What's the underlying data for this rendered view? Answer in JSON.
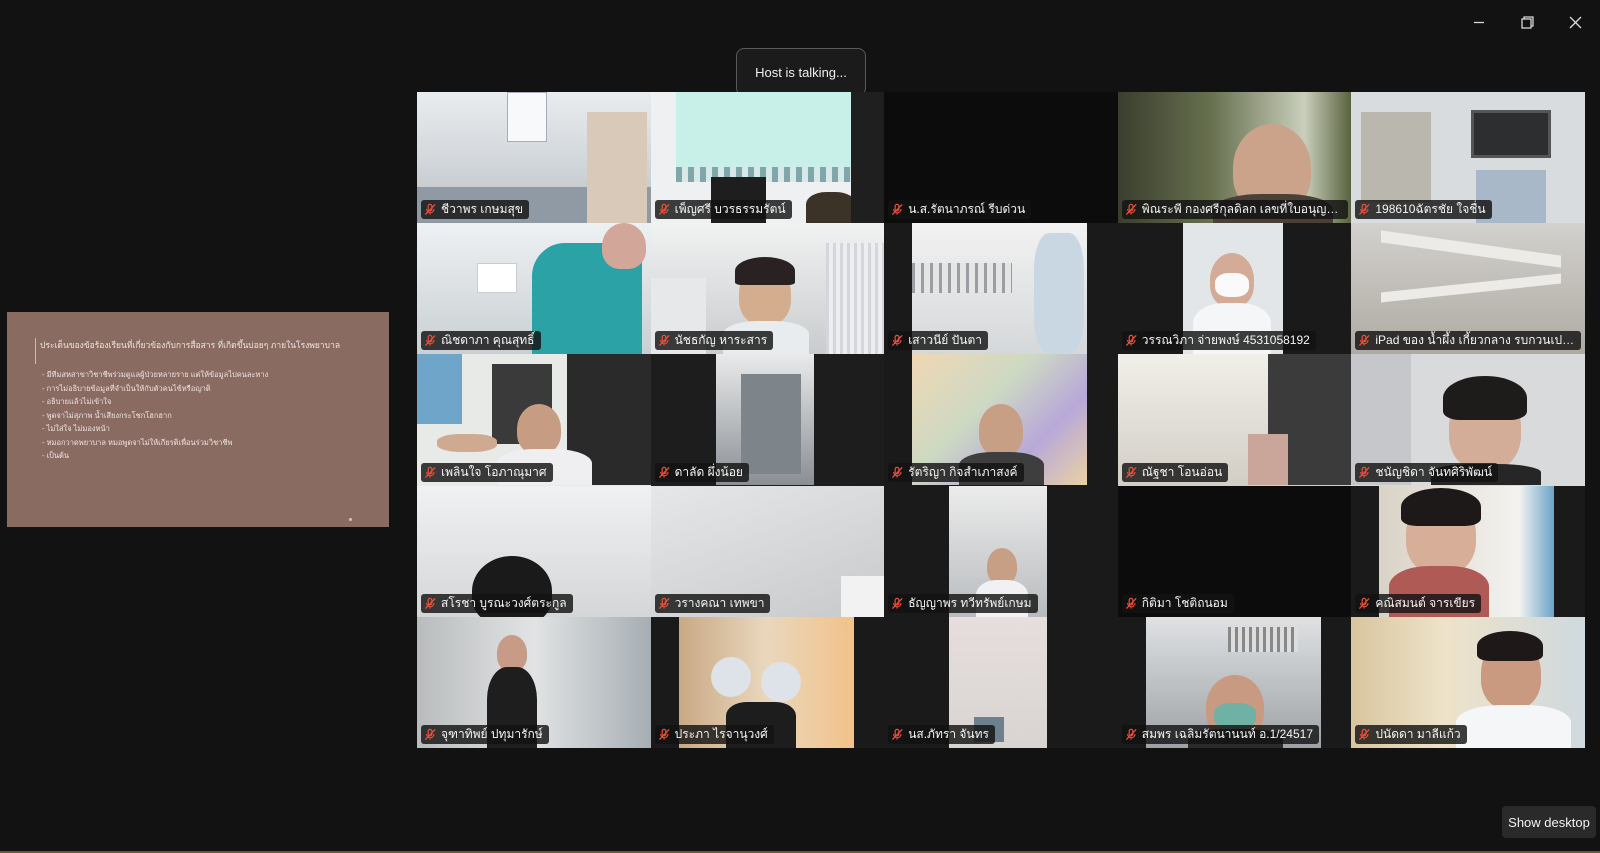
{
  "toast": {
    "text": "Host is talking..."
  },
  "slide": {
    "title": "ประเด็นของข้อร้องเรียนที่เกี่ยวข้องกับการสื่อสาร ที่เกิดขึ้นบ่อยๆ ภายในโรงพยาบาล",
    "items": [
      "- มีทีมสหสาขาวิชาชีพร่วมดูแลผู้ป่วยหลายราย แต่ให้ข้อมูลไปคนละทาง",
      "- การไม่อธิบายข้อมูลที่จำเป็นให้กับตัวคนไข้หรือญาติ",
      "- อธิบายแล้วไม่เข้าใจ",
      "- พูดจาไม่สุภาพ น้ำเสียงกระโชกโฮกฮาก",
      "- ไม่ใส่ใจ ไม่มองหน้า",
      "- หมอกวาดพยาบาล หมอพูดจาไม่ให้เกียรติเพื่อนร่วมวิชาชีพ",
      "- เป็นต้น"
    ]
  },
  "participants": [
    {
      "name": "ชีวาพร เกษมสุข",
      "scene": "office-ceiling"
    },
    {
      "name": "เพ็ญศรี บวรธรรมรัตน์",
      "scene": "white-wall"
    },
    {
      "name": "น.ส.รัตนาภรณ์ รีบด่วน",
      "scene": "black"
    },
    {
      "name": "พิณระพี กองศรีกุลดิลก เลขที่ใบอนุญาต...",
      "scene": "window-woman"
    },
    {
      "name": "198610ฉัตรชัย ใจชื่น",
      "scene": "nurse-station"
    },
    {
      "name": "ณิชดาภา คุณสุทธิ์",
      "scene": "teal-shirt"
    },
    {
      "name": "นัชธกัญ หาระสาร",
      "scene": "woman-room"
    },
    {
      "name": "เสาวนีย์ ปันตา",
      "scene": "ceiling-ac"
    },
    {
      "name": "วรรณวิภา จ่ายพงษ์ 4531058192",
      "scene": "mask-woman"
    },
    {
      "name": "iPad ของ น้ำผึ้ง เกี้ยวกลาง รบกวนเปลี่ย...",
      "scene": "hallway"
    },
    {
      "name": "เพลินใจ โอภาณุมาศ",
      "scene": "woman-desk"
    },
    {
      "name": "ดาลัด ผึ่งน้อย",
      "scene": "cabinet"
    },
    {
      "name": "รัตริญา กิจสำเภาสงค์",
      "scene": "mural"
    },
    {
      "name": "ณัฐชา โอนอ่อน",
      "scene": "bright-office"
    },
    {
      "name": "ชนัญชิดา จันทศิริพัฒน์",
      "scene": "glasses-woman"
    },
    {
      "name": "สโรชา บูรณะวงศ์ตระกูล",
      "scene": "blur-face"
    },
    {
      "name": "วรางคณา เทพขา",
      "scene": "blank-wall"
    },
    {
      "name": "ธัญญาพร ทวีทรัพย์เกษม",
      "scene": "small-woman"
    },
    {
      "name": "กิติมา โชติถนอม",
      "scene": "black"
    },
    {
      "name": "คณิสมนต์ จารเขียร",
      "scene": "older-woman"
    },
    {
      "name": "จุฑาทิพย์ ปทุมารักษ์",
      "scene": "standing-woman"
    },
    {
      "name": "ประภา ไรจานุวงศ์",
      "scene": "office-chair"
    },
    {
      "name": "นส.ภัทรา จันทร",
      "scene": "pink-wall"
    },
    {
      "name": "สมพร เฉลิมรัตนานนท์ อ.1/24517",
      "scene": "masked-man"
    },
    {
      "name": "ปนัดดา มาลีแก้ว",
      "scene": "smiling-woman"
    }
  ],
  "show_desktop": {
    "label": "Show desktop"
  },
  "icons": {
    "minimize": "minimize-icon",
    "restore": "restore-icon",
    "close": "close-icon",
    "mic_muted": "mic-muted-icon"
  },
  "colors": {
    "mic_muted": "#e8503a",
    "slide_bg": "#8a6b62",
    "background": "#121212"
  }
}
